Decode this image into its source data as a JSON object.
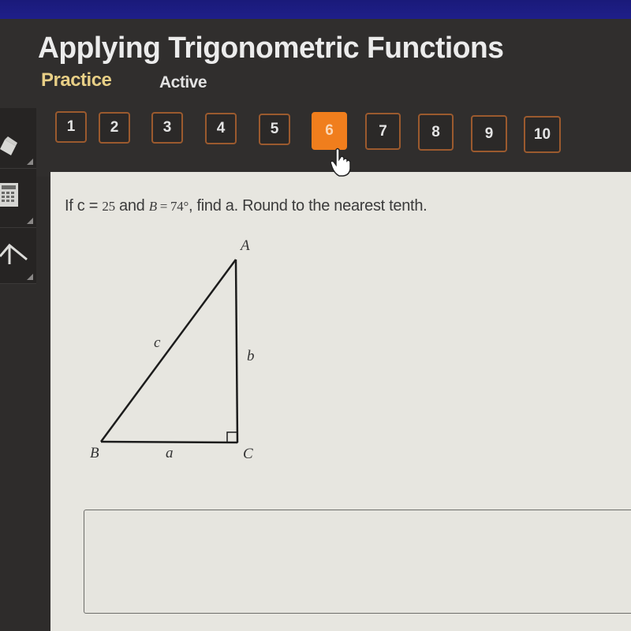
{
  "window": {
    "title": "Applying Trigonometric Functions"
  },
  "tabs": [
    {
      "label": "Practice",
      "selected": true
    },
    {
      "label": "Active",
      "selected": false
    }
  ],
  "question_nav": {
    "buttons": [
      "1",
      "2",
      "3",
      "4",
      "5",
      "6",
      "7",
      "8",
      "9",
      "10"
    ],
    "current": "6",
    "colors": {
      "current": "#f07e1d",
      "border": "#9b5a2e"
    }
  },
  "side_tools": [
    {
      "icon": "pencil-icon"
    },
    {
      "icon": "calculator-icon"
    },
    {
      "icon": "arrow-up-icon"
    }
  ],
  "question": {
    "prefix": "If c = ",
    "c_value": "25",
    "mid": " and ",
    "B_var": "B",
    "equals": " = ",
    "B_value": "74°",
    "suffix": ", find a. Round to the nearest tenth."
  },
  "diagram": {
    "vertices": {
      "A": "A",
      "B": "B",
      "C": "C"
    },
    "sides": {
      "a": "a",
      "b": "b",
      "c": "c"
    },
    "right_angle_at": "C"
  },
  "answer": {
    "value": ""
  }
}
